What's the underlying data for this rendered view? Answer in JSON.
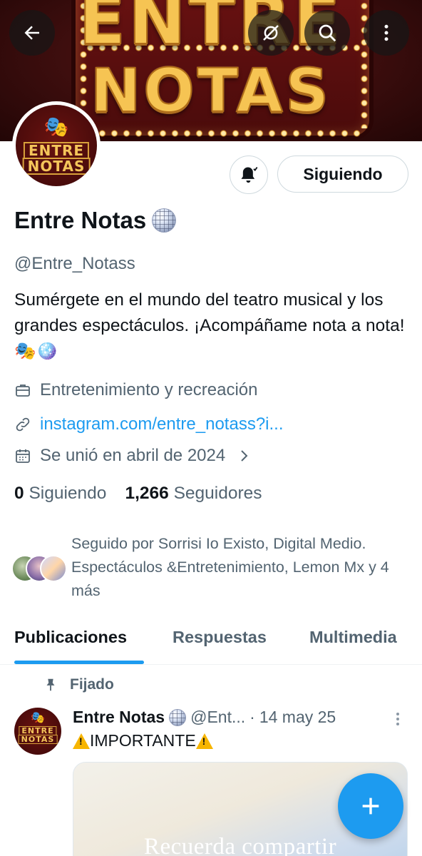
{
  "banner": {
    "line1": "ENTRE",
    "line2": "NOTAS"
  },
  "avatar_logo": {
    "line1": "ENTRE",
    "line2": "NOTAS"
  },
  "actions": {
    "follow_label": "Siguiendo"
  },
  "profile": {
    "name": "Entre Notas",
    "handle": "@Entre_Notass",
    "bio": "Sumérgete en el mundo del teatro musical y los grandes espectáculos. ¡Acompáñame nota a nota! 🎭🪩",
    "category": "Entretenimiento y recreación",
    "link": "instagram.com/entre_notass?i...",
    "joined": "Se unió en abril de 2024",
    "following_count": "0",
    "following_label": "Siguiendo",
    "followers_count": "1,266",
    "followers_label": "Seguidores",
    "followed_by": "Seguido por Sorrisi Io Existo, Digital Medio. Espectáculos &Entretenimiento, Lemon Mx y 4 más"
  },
  "tabs": [
    {
      "label": "Publicaciones",
      "active": true
    },
    {
      "label": "Respuestas",
      "active": false
    },
    {
      "label": "Multimedia",
      "active": false
    }
  ],
  "post": {
    "pinned_label": "Fijado",
    "author_name": "Entre Notas",
    "author_handle": "@Ent...",
    "separator": "·",
    "date": "14 may 25",
    "text": "IMPORTANTE",
    "media_caption": "Recuerda compartir"
  },
  "colors": {
    "accent": "#1d9bf0",
    "text": "#0f1419",
    "muted": "#536471"
  },
  "icons": [
    "back-arrow-icon",
    "hide-icon",
    "search-icon",
    "more-vertical-icon",
    "bell-icon",
    "briefcase-icon",
    "link-icon",
    "calendar-icon",
    "chevron-right-icon",
    "pin-icon",
    "plus-icon",
    "warning-icon",
    "disco-ball-icon"
  ]
}
